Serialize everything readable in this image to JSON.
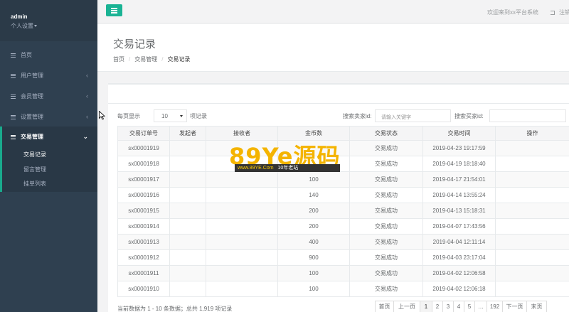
{
  "sidebar": {
    "user": "admin",
    "settings": "个人设置",
    "items": [
      {
        "label": "首页"
      },
      {
        "label": "用户管理"
      },
      {
        "label": "会员管理"
      },
      {
        "label": "设置管理"
      },
      {
        "label": "交易管理"
      }
    ],
    "submenu": [
      {
        "label": "交易记录"
      },
      {
        "label": "留言管理"
      },
      {
        "label": "挂单列表"
      }
    ]
  },
  "topbar": {
    "welcome": "欢迎来到xx平台系统",
    "logout": "注销"
  },
  "page": {
    "title": "交易记录",
    "breadcrumb": [
      "首页",
      "交易管理",
      "交易记录"
    ]
  },
  "toolbar": {
    "length_label": "每页显示",
    "length_value": "10",
    "length_suffix": "项记录",
    "seller_label": "搜索卖家id:",
    "seller_placeholder": "请输入关键字",
    "buyer_label": "搜索买家id:"
  },
  "table": {
    "headers": [
      "交易订单号",
      "发起者",
      "接收者",
      "金币数",
      "交易状态",
      "交易时间",
      "操作"
    ],
    "rows": [
      [
        "sx00001919",
        "",
        "",
        "",
        "交易成功",
        "2019-04-23 19:17:59",
        ""
      ],
      [
        "sx00001918",
        "",
        "",
        "",
        "交易成功",
        "2019-04-19 18:18:40",
        ""
      ],
      [
        "sx00001917",
        "",
        "",
        "100",
        "交易成功",
        "2019-04-17 21:54:01",
        ""
      ],
      [
        "sx00001916",
        "",
        "",
        "140",
        "交易成功",
        "2019-04-14 13:55:24",
        ""
      ],
      [
        "sx00001915",
        "",
        "",
        "200",
        "交易成功",
        "2019-04-13 15:18:31",
        ""
      ],
      [
        "sx00001914",
        "",
        "",
        "200",
        "交易成功",
        "2019-04-07 17:43:56",
        ""
      ],
      [
        "sx00001913",
        "",
        "",
        "400",
        "交易成功",
        "2019-04-04 12:11:14",
        ""
      ],
      [
        "sx00001912",
        "",
        "",
        "900",
        "交易成功",
        "2019-04-03 23:17:04",
        ""
      ],
      [
        "sx00001911",
        "",
        "",
        "100",
        "交易成功",
        "2019-04-02 12:06:58",
        ""
      ],
      [
        "sx00001910",
        "",
        "",
        "100",
        "交易成功",
        "2019-04-02 12:06:18",
        ""
      ]
    ]
  },
  "footer": {
    "info": "当前数据为 1 - 10 条数据；总共 1,919 项记录",
    "pager": [
      "首页",
      "上一页",
      "1",
      "2",
      "3",
      "4",
      "5",
      "…",
      "192",
      "下一页",
      "末页"
    ],
    "active_page": "1"
  },
  "watermark": {
    "big": "89Ye源码",
    "url": "www.89YE.Com",
    "tag": "10年老站"
  }
}
